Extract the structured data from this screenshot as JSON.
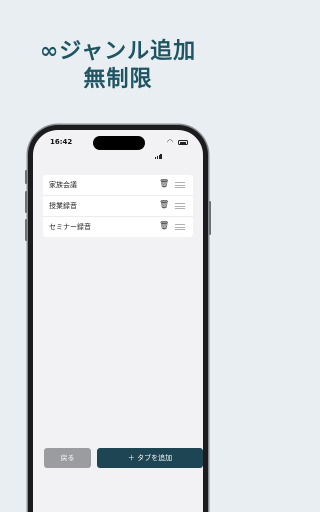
{
  "headline": {
    "line1": "∞ジャンル追加",
    "line2": "無制限"
  },
  "status_bar": {
    "time": "16:42"
  },
  "genres": [
    {
      "label": "家族会議"
    },
    {
      "label": "授業録音"
    },
    {
      "label": "セミナー録音"
    }
  ],
  "icons": {
    "delete": "trash-icon",
    "reorder": "drag-handle-icon"
  },
  "buttons": {
    "back": "戻る",
    "add_tab": "＋ タブを追加"
  },
  "colors": {
    "background": "#e8eef1",
    "headline": "#1f5563",
    "add_button": "#1d4553",
    "back_button": "#9a9ca0"
  }
}
